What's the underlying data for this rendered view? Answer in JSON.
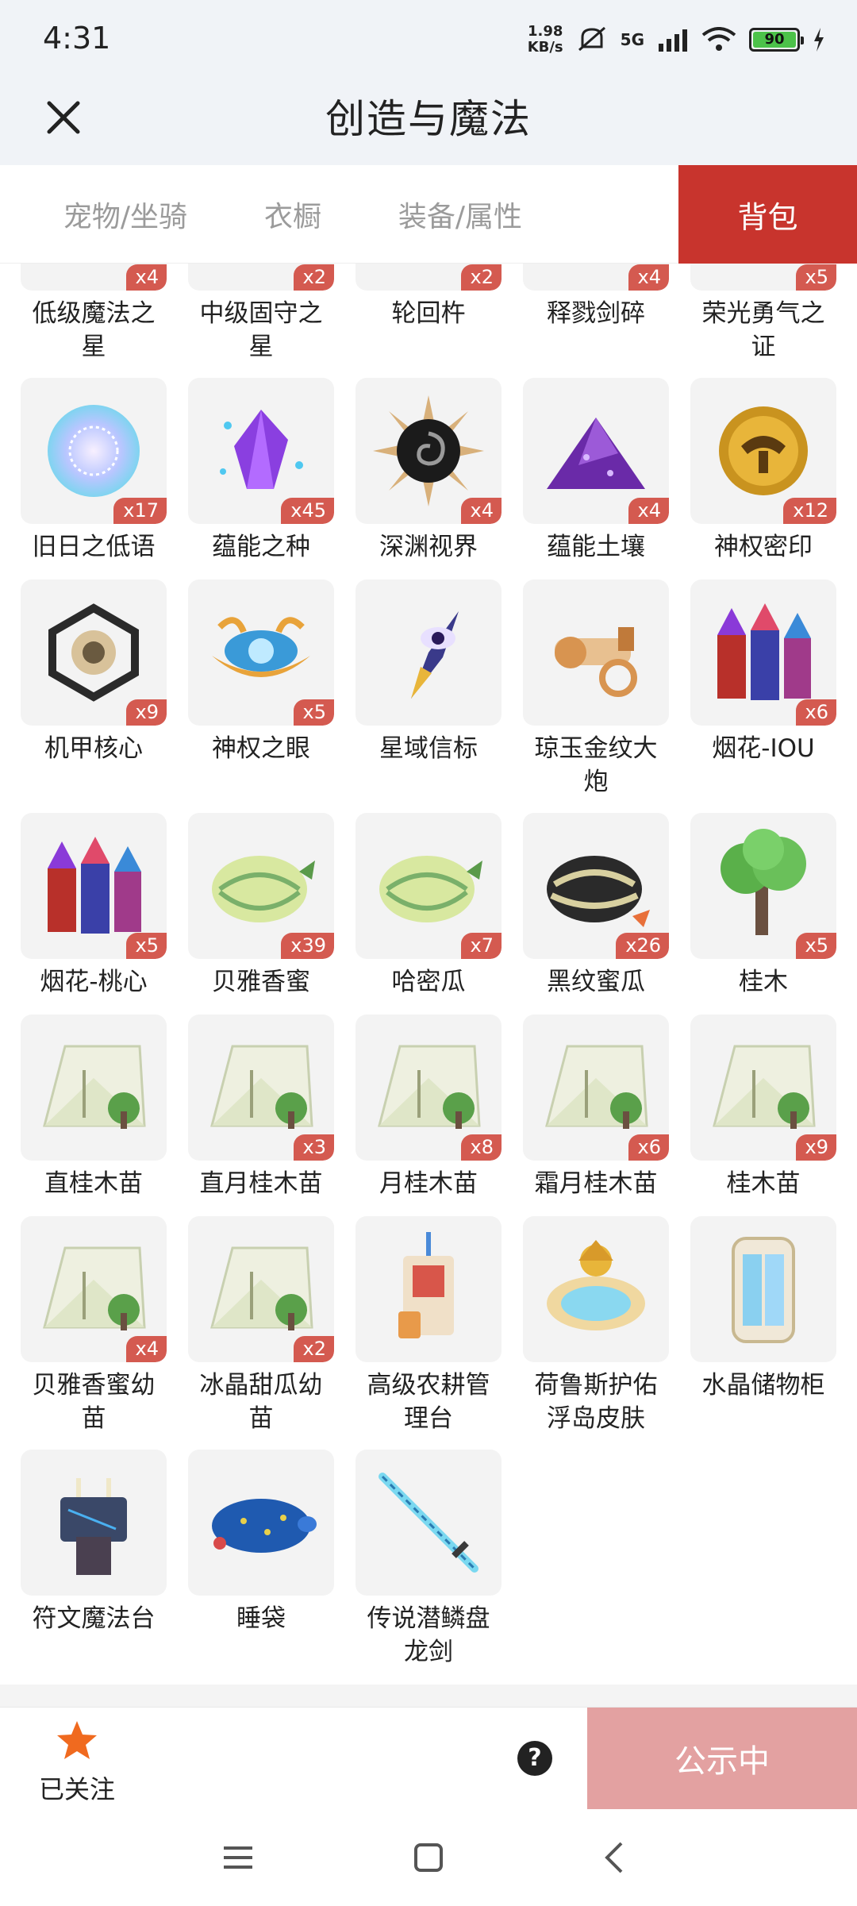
{
  "status_bar": {
    "time": "4:31",
    "net_speed_value": "1.98",
    "net_speed_unit": "KB/s",
    "signal": "5G",
    "battery": "90"
  },
  "header": {
    "title": "创造与魔法",
    "close_icon": "close-icon"
  },
  "tabs": [
    {
      "label": "宠物/坐骑",
      "active": false
    },
    {
      "label": "衣橱",
      "active": false
    },
    {
      "label": "装备/属性",
      "active": false
    },
    {
      "label": "背包",
      "active": true
    }
  ],
  "items": [
    {
      "name": "低级魔法之\n星",
      "count": "x4",
      "icon": "star-icon"
    },
    {
      "name": "中级固守之\n星",
      "count": "x2",
      "icon": "star-icon"
    },
    {
      "name": "轮回杵",
      "count": "x2",
      "icon": "pestle-icon"
    },
    {
      "name": "释戮剑碎",
      "count": "x4",
      "icon": "shard-icon"
    },
    {
      "name": "荣光勇气之\n证",
      "count": "x5",
      "icon": "badge-icon"
    },
    {
      "name": "旧日之低语",
      "count": "x17",
      "icon": "orb-icon"
    },
    {
      "name": "蕴能之种",
      "count": "x45",
      "icon": "crystal-icon"
    },
    {
      "name": "深渊视界",
      "count": "x4",
      "icon": "abyss-sun-icon"
    },
    {
      "name": "蕴能土壤",
      "count": "x4",
      "icon": "soil-icon"
    },
    {
      "name": "神权密印",
      "count": "x12",
      "icon": "gold-seal-icon"
    },
    {
      "name": "机甲核心",
      "count": "x9",
      "icon": "mech-core-icon"
    },
    {
      "name": "神权之眼",
      "count": "x5",
      "icon": "divine-eye-icon"
    },
    {
      "name": "星域信标",
      "count": "",
      "icon": "beacon-icon"
    },
    {
      "name": "琼玉金纹大\n炮",
      "count": "",
      "icon": "cannon-icon"
    },
    {
      "name": "烟花-IOU",
      "count": "x6",
      "icon": "fireworks-icon"
    },
    {
      "name": "烟花-桃心",
      "count": "x5",
      "icon": "fireworks-icon"
    },
    {
      "name": "贝雅香蜜",
      "count": "x39",
      "icon": "melon-icon"
    },
    {
      "name": "哈密瓜",
      "count": "x7",
      "icon": "melon-icon"
    },
    {
      "name": "黑纹蜜瓜",
      "count": "x26",
      "icon": "dark-melon-icon"
    },
    {
      "name": "桂木",
      "count": "x5",
      "icon": "tree-icon"
    },
    {
      "name": "直桂木苗",
      "count": "",
      "icon": "seed-pack-icon"
    },
    {
      "name": "直月桂木苗",
      "count": "x3",
      "icon": "seed-pack-icon"
    },
    {
      "name": "月桂木苗",
      "count": "x8",
      "icon": "seed-pack-icon"
    },
    {
      "name": "霜月桂木苗",
      "count": "x6",
      "icon": "seed-pack-icon"
    },
    {
      "name": "桂木苗",
      "count": "x9",
      "icon": "seed-pack-icon"
    },
    {
      "name": "贝雅香蜜幼\n苗",
      "count": "x4",
      "icon": "seed-pack-icon"
    },
    {
      "name": "冰晶甜瓜幼\n苗",
      "count": "x2",
      "icon": "seed-pack-icon"
    },
    {
      "name": "高级农耕管\n理台",
      "count": "",
      "icon": "farm-station-icon"
    },
    {
      "name": "荷鲁斯护佑\n浮岛皮肤",
      "count": "",
      "icon": "island-icon"
    },
    {
      "name": "水晶储物柜",
      "count": "",
      "icon": "cabinet-icon"
    },
    {
      "name": "符文魔法台",
      "count": "",
      "icon": "rune-altar-icon"
    },
    {
      "name": "睡袋",
      "count": "",
      "icon": "sleeping-bag-icon"
    },
    {
      "name": "传说潜鳞盘\n龙剑",
      "count": "",
      "icon": "sword-icon"
    }
  ],
  "bottom_bar": {
    "follow_label": "已关注",
    "help": "?",
    "publish_label": "公示中"
  },
  "colors": {
    "accent": "#c8342d",
    "badge": "#d45a50",
    "publish": "#e3a1a1",
    "follow_star": "#f06a1f"
  }
}
